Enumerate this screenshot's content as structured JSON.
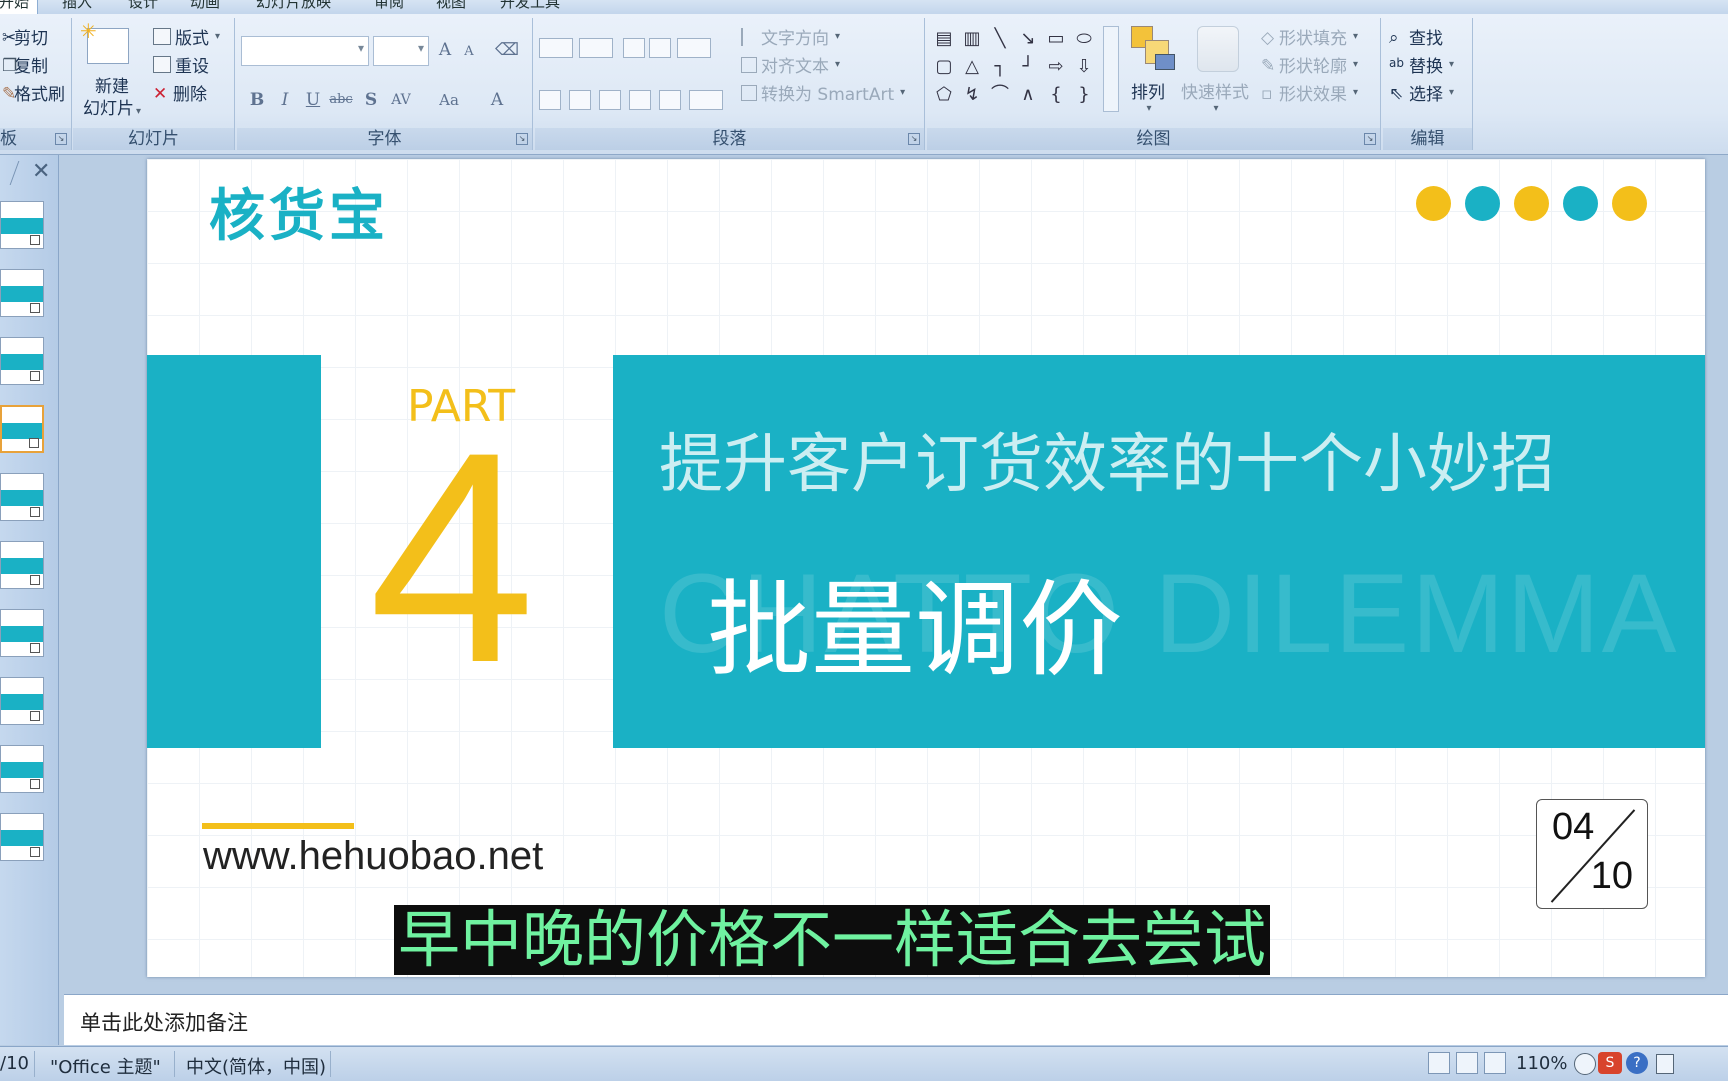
{
  "menu": {
    "tabs": [
      "开始",
      "插入",
      "设计",
      "动画",
      "幻灯片放映",
      "审阅",
      "视图",
      "开发工具"
    ]
  },
  "ribbon": {
    "clipboard": {
      "cut": "剪切",
      "copy": "复制",
      "format_painter": "格式刷",
      "label": "板"
    },
    "slides": {
      "new_slide_line1": "新建",
      "new_slide_line2": "幻灯片",
      "layout": "版式",
      "reset": "重设",
      "delete": "删除",
      "label": "幻灯片"
    },
    "font": {
      "label": "字体",
      "bold": "B",
      "italic": "I",
      "underline": "U",
      "strike": "abc",
      "shadow": "S",
      "spacing": "AV",
      "case": "Aa",
      "color": "A",
      "grow": "A",
      "shrink": "A"
    },
    "paragraph": {
      "text_direction": "文字方向",
      "align_text": "对齐文本",
      "smartart": "转换为 SmartArt",
      "label": "段落"
    },
    "drawing": {
      "arrange": "排列",
      "quick_styles": "快速样式",
      "shape_fill": "形状填充",
      "shape_outline": "形状轮廓",
      "shape_effects": "形状效果",
      "label": "绘图"
    },
    "editing": {
      "find": "查找",
      "replace": "替换",
      "select": "选择",
      "label": "编辑"
    }
  },
  "slide": {
    "logo": "核货宝",
    "dot_colors": [
      "#f3bf1a",
      "#1ab1c5",
      "#f3bf1a",
      "#1ab1c5",
      "#f3bf1a"
    ],
    "part_label": "PART",
    "part_number": "4",
    "subtitle": "提升客户订货效率的十个小妙招",
    "ghost_text": "CHATTO DILEMMA",
    "title": "批量调价",
    "url": "www.hehuobao.net",
    "page_current": "04",
    "page_total": "10",
    "accent_color": "#1ab1c5",
    "highlight_color": "#f3bf1a"
  },
  "caption": "早中晚的价格不一样适合去尝试",
  "notes_placeholder": "单击此处添加备注",
  "status": {
    "slide_indicator": "/10",
    "theme": "\"Office 主题\"",
    "language": "中文(简体，中国)",
    "zoom": "110%"
  }
}
